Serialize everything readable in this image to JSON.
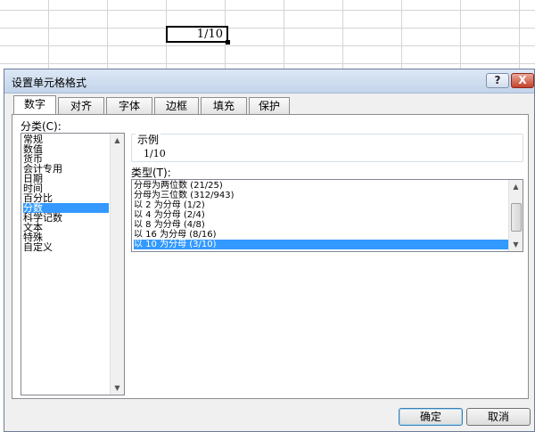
{
  "sheet": {
    "cell_value": "1/10"
  },
  "dialog": {
    "title": "设置单元格格式",
    "help_label": "?",
    "close_label": "X",
    "tabs": [
      {
        "label": "数字"
      },
      {
        "label": "对齐"
      },
      {
        "label": "字体"
      },
      {
        "label": "边框"
      },
      {
        "label": "填充"
      },
      {
        "label": "保护"
      }
    ],
    "category_label": "分类(C):",
    "categories": [
      "常规",
      "数值",
      "货币",
      "会计专用",
      "日期",
      "时间",
      "百分比",
      "分数",
      "科学记数",
      "文本",
      "特殊",
      "自定义"
    ],
    "selected_category": "分数",
    "sample_title": "示例",
    "sample_value": "1/10",
    "type_label": "类型(T):",
    "types": [
      "分母为两位数 (21/25)",
      "分母为三位数 (312/943)",
      "以 2 为分母 (1/2)",
      "以 4 为分母 (2/4)",
      "以 8 为分母 (4/8)",
      "以 16 为分母 (8/16)",
      "以 10 为分母 (3/10)"
    ],
    "selected_type": "以 10 为分母 (3/10)",
    "ok_label": "确定",
    "cancel_label": "取消"
  },
  "colors": {
    "selection": "#3399ff",
    "dialog_bg": "#f0f0f0",
    "titlebar": "#c3d4ea"
  }
}
